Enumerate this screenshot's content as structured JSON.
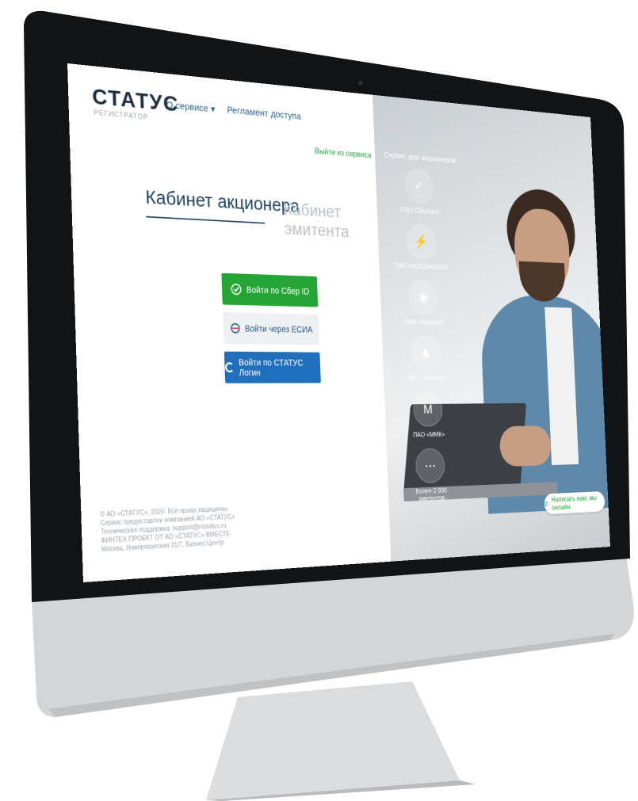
{
  "header": {
    "logo": "СТАТУС",
    "logo_sub": "РЕГИСТРАТОР",
    "nav_about": "О сервисе ▾",
    "nav_registry": "Регламент доступа",
    "exit_link": "Выйти из сервиса"
  },
  "tabs": {
    "shareholder": "Кабинет акционера",
    "issuer": "Кабинет эмитента"
  },
  "buttons": {
    "sber": "Войти по Сбер ID",
    "esia": "Войти через ЕСИА",
    "status_login": "Войти по СТАТУС Логин"
  },
  "footer": {
    "lines": [
      "© АО «СТАТУС», 2020. Все права защищены.",
      "Сервис предоставлен компанией АО «СТАТУС»",
      "Техническая поддержка: support@rostatus.ru",
      "ФИНТЕХ ПРОЕКТ ОТ АО «СТАТУС» ВМЕСТЕ",
      "Москва, Новорязанская 31/7, Бизнес-Центр"
    ]
  },
  "partners": {
    "title": "Сервис для акционеров:",
    "items": [
      {
        "label": "ПАО Сбербанк",
        "icon": "checkmark-icon"
      },
      {
        "label": "ПАО «МОСЭНЕРГО»",
        "icon": "mosenergo-icon"
      },
      {
        "label": "ПАО «Россети»",
        "icon": "rosseti-icon"
      },
      {
        "label": "ПАО «КАМАЗ»",
        "icon": "kamaz-icon"
      },
      {
        "label": "ПАО «ММК»",
        "icon": "mmk-icon"
      },
      {
        "label": "Более 2 000 эмитентов",
        "icon": "more-icon"
      }
    ]
  },
  "help": {
    "label": "Написать нам, мы онлайн"
  },
  "colors": {
    "accent_green": "#25a536",
    "accent_blue": "#1f6fbd",
    "text_dark": "#1d3e5e"
  }
}
